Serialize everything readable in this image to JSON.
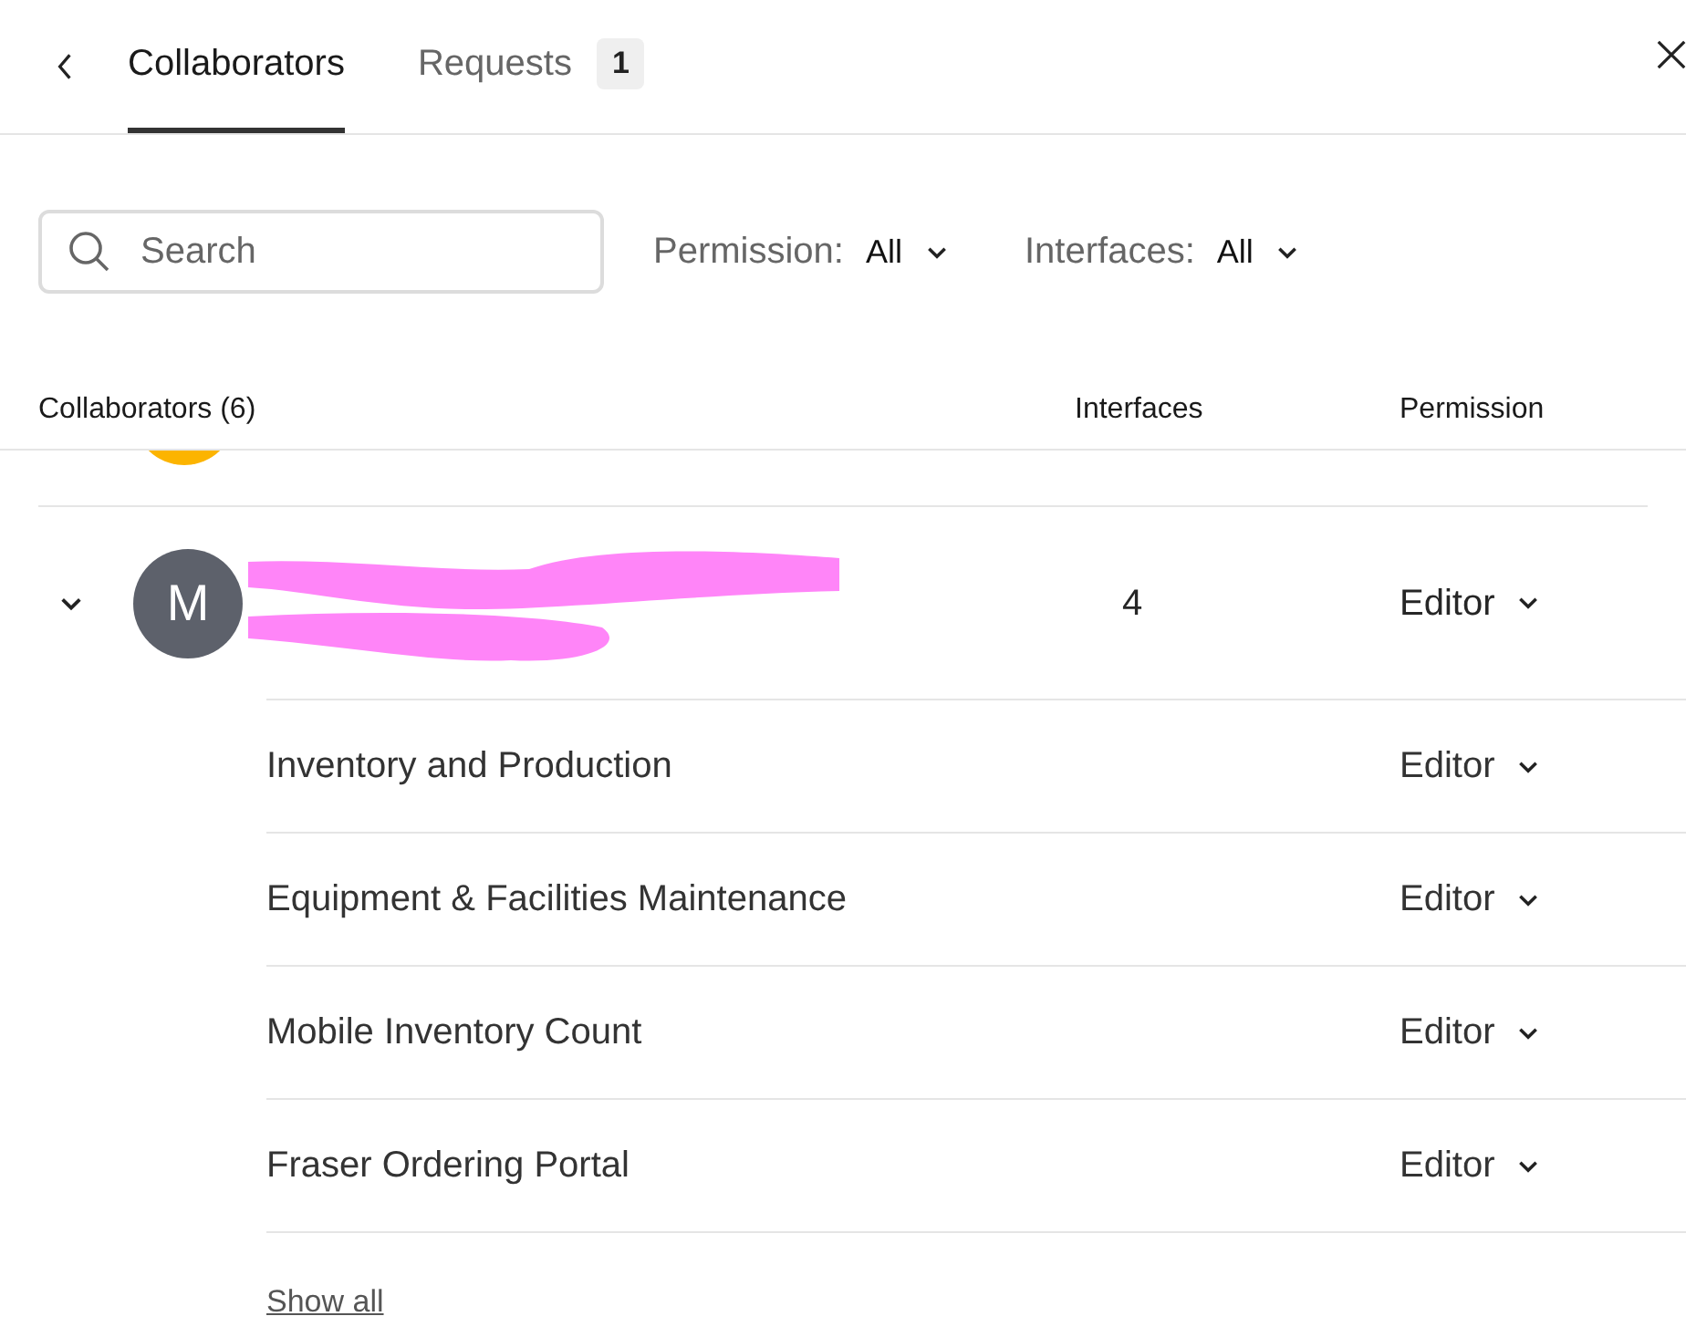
{
  "tabs": [
    {
      "label": "Collaborators",
      "selected": true
    },
    {
      "label": "Requests",
      "selected": false,
      "badge": "1"
    }
  ],
  "search": {
    "placeholder": "Search"
  },
  "filters": [
    {
      "label": "Permission:",
      "value": "All"
    },
    {
      "label": "Interfaces:",
      "value": "All"
    }
  ],
  "table": {
    "columns": [
      "Collaborators (6)",
      "Interfaces",
      "Permission"
    ],
    "collaborator": {
      "initial": "M",
      "expanded": true,
      "interfaces": "4",
      "permission": "Editor",
      "interfaces_list": [
        {
          "name": "Inventory and Production",
          "permission": "Editor"
        },
        {
          "name": "Equipment & Facilities Maintenance",
          "permission": "Editor"
        },
        {
          "name": "Mobile Inventory Count",
          "permission": "Editor"
        },
        {
          "name": "Fraser Ordering Portal",
          "permission": "Editor"
        }
      ]
    }
  },
  "show_all": "Show all"
}
